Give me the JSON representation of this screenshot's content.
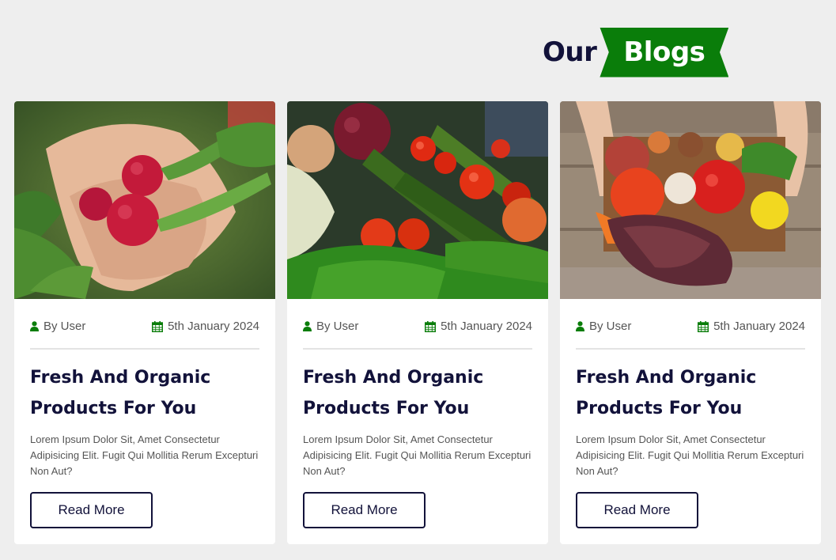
{
  "section": {
    "title_part1": "Our",
    "title_part2": "Blogs"
  },
  "colors": {
    "accent": "#0a7d0a",
    "heading": "#12123a",
    "background": "#eeeeee"
  },
  "cards": [
    {
      "image": "radishes-in-hands-photo",
      "author": "By User",
      "date": "5th January 2024",
      "title": "Fresh And Organic Products For You",
      "description": "Lorem Ipsum Dolor Sit, Amet Consectetur Adipisicing Elit. Fugit Qui Mollitia Rerum Excepturi Non Aut?",
      "button": "Read More"
    },
    {
      "image": "fresh-vegetables-photo",
      "author": "By User",
      "date": "5th January 2024",
      "title": "Fresh And Organic Products For You",
      "description": "Lorem Ipsum Dolor Sit, Amet Consectetur Adipisicing Elit. Fugit Qui Mollitia Rerum Excepturi Non Aut?",
      "button": "Read More"
    },
    {
      "image": "vegetable-crate-photo",
      "author": "By User",
      "date": "5th January 2024",
      "title": "Fresh And Organic Products For You",
      "description": "Lorem Ipsum Dolor Sit, Amet Consectetur Adipisicing Elit. Fugit Qui Mollitia Rerum Excepturi Non Aut?",
      "button": "Read More"
    }
  ]
}
